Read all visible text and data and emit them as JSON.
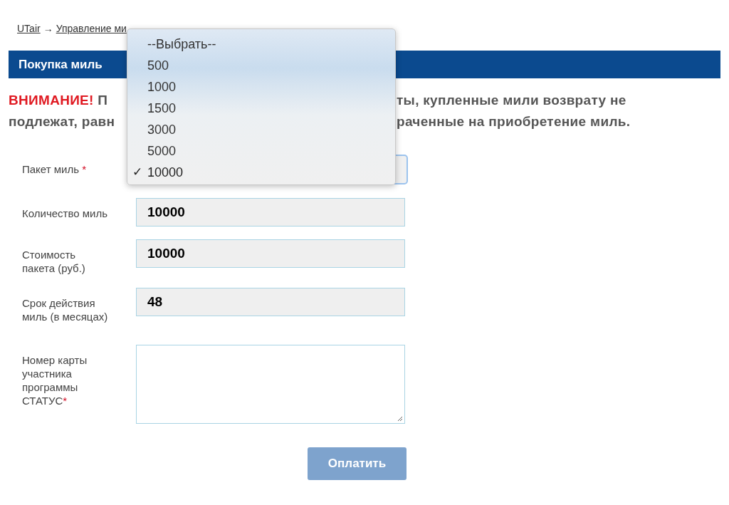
{
  "breadcrumb": [
    {
      "label": "UTair"
    },
    {
      "label": "Управление ми"
    }
  ],
  "breadcrumb_separators": [
    "→"
  ],
  "header": {
    "title": "Покупка миль"
  },
  "warning": {
    "lead": "ВНИМАНИЕ!",
    "lines": [
      {
        "left": "П",
        "right": "ты, купленные  мили возврату не"
      },
      {
        "left": "подлежат, равн",
        "right": "раченные на приобретение миль."
      }
    ]
  },
  "form": {
    "package": {
      "label": "Пакет миль",
      "required_mark": "*"
    },
    "fields": [
      {
        "label": "Количество миль",
        "value": "10000",
        "kind": "input"
      },
      {
        "label": "Стоимость пакета (руб.)",
        "value": "10000",
        "kind": "input"
      },
      {
        "label": "Срок действия миль (в месяцах)",
        "value": "48",
        "kind": "input"
      },
      {
        "label": "Номер карты участника программы СТАТУС",
        "required_mark": "*",
        "kind": "textarea"
      }
    ],
    "submit": "Оплатить"
  },
  "dropdown": {
    "options": [
      {
        "label": "--Выбрать--",
        "selected": false
      },
      {
        "label": "500",
        "selected": false
      },
      {
        "label": "1000",
        "selected": false
      },
      {
        "label": "1500",
        "selected": false
      },
      {
        "label": "3000",
        "selected": false
      },
      {
        "label": "5000",
        "selected": false
      },
      {
        "label": "10000",
        "selected": true
      }
    ],
    "check": "✓"
  }
}
